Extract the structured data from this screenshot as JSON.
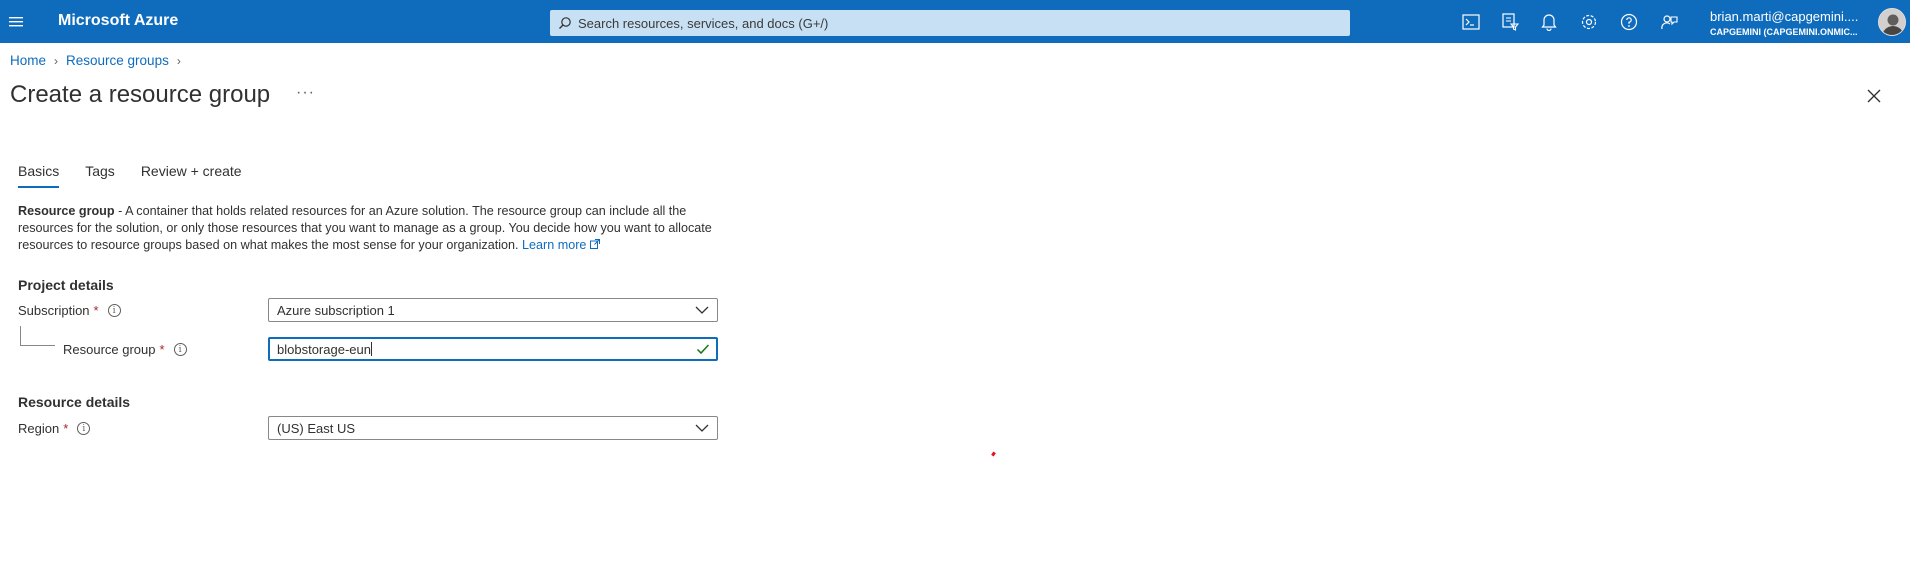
{
  "topbar": {
    "brand": "Microsoft Azure",
    "search_placeholder": "Search resources, services, and docs (G+/)",
    "icons": [
      "cloud-shell-icon",
      "directory-filter-icon",
      "notifications-icon",
      "settings-icon",
      "help-icon",
      "feedback-icon"
    ],
    "user_name": "brian.marti@capgemini....",
    "user_directory": "CAPGEMINI (CAPGEMINI.ONMIC..."
  },
  "breadcrumb": [
    "Home",
    "Resource groups"
  ],
  "page": {
    "title": "Create a resource group",
    "more": "···"
  },
  "tabs": [
    "Basics",
    "Tags",
    "Review + create"
  ],
  "description": {
    "bold": "Resource group",
    "text": " - A container that holds related resources for an Azure solution. The resource group can include all the resources for the solution, or only those resources that you want to manage as a group. You decide how you want to allocate resources to resource groups based on what makes the most sense for your organization. ",
    "link": "Learn more"
  },
  "project_details": {
    "heading": "Project details",
    "subscription_label": "Subscription",
    "subscription_value": "Azure subscription 1",
    "resource_group_label": "Resource group",
    "resource_group_value": "blobstorage-eun"
  },
  "resource_details": {
    "heading": "Resource details",
    "region_label": "Region",
    "region_value": "(US) East US"
  },
  "colors": {
    "topbar": "#0f6cbd",
    "accent": "#0f6cbd",
    "required": "#a4262c",
    "valid": "#107c10"
  }
}
